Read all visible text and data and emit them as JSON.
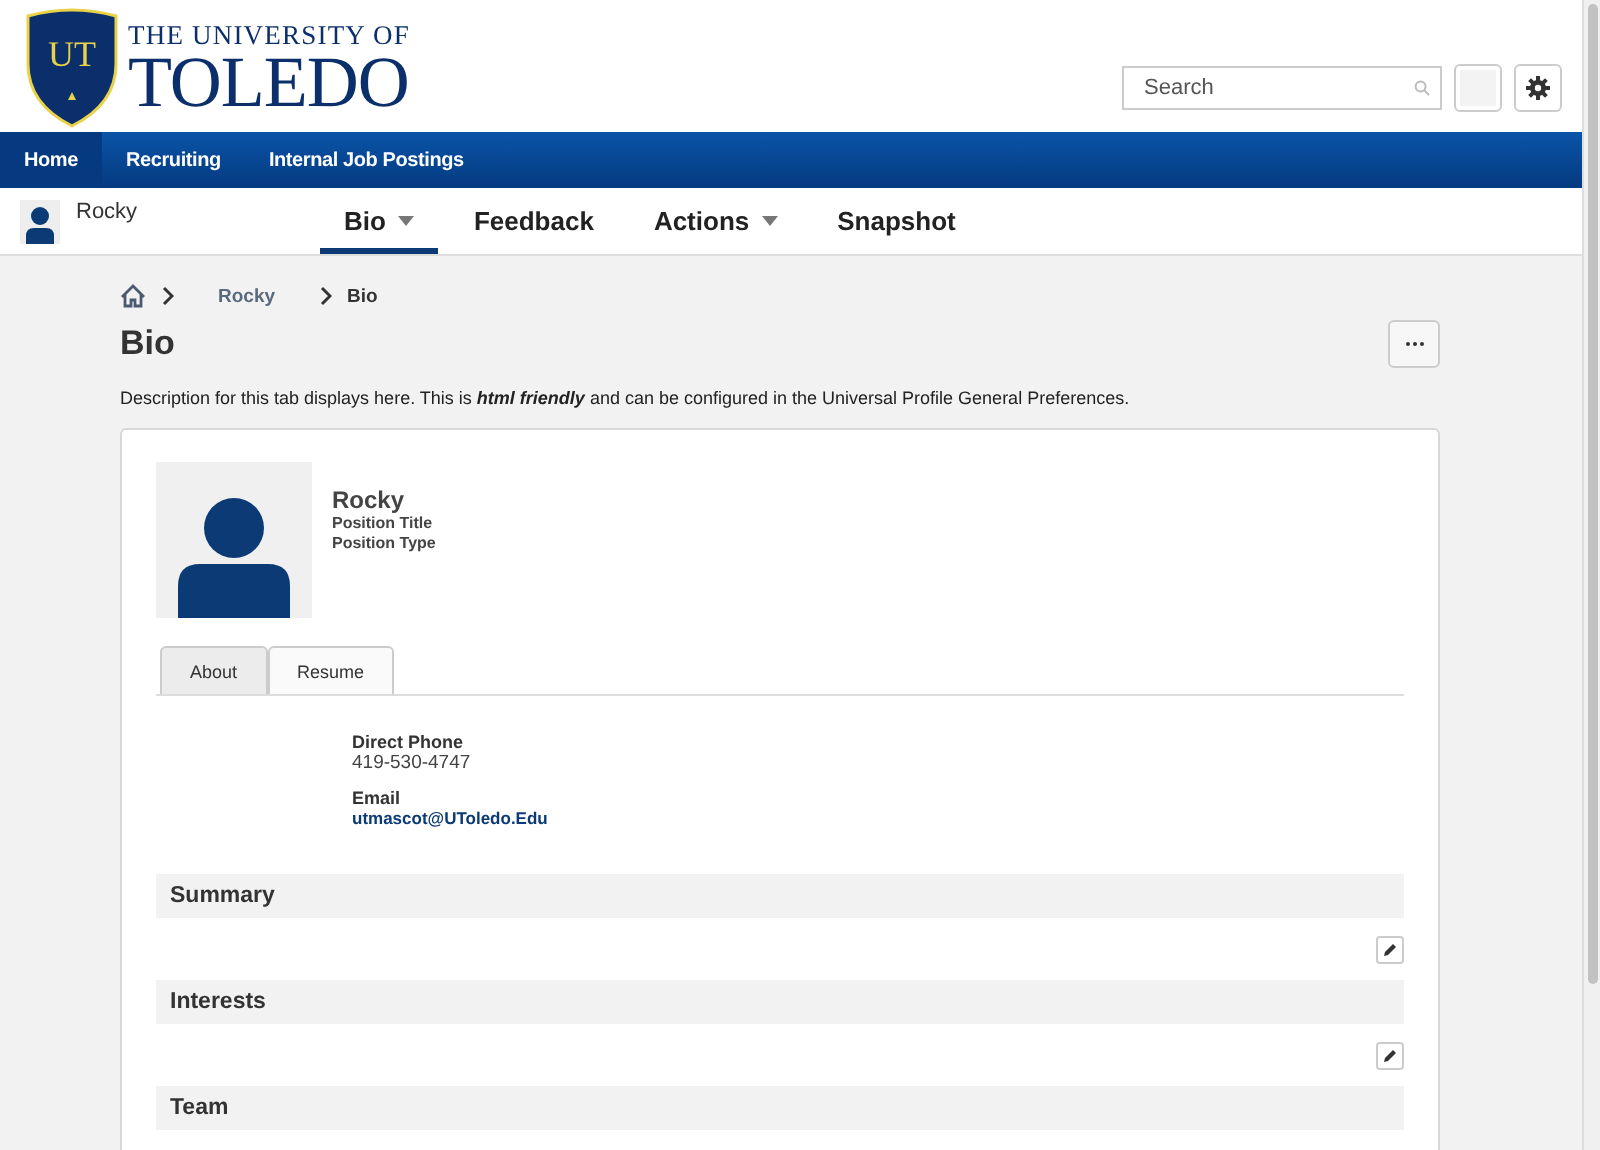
{
  "logo": {
    "monogram": "UT",
    "line1": "THE UNIVERSITY OF",
    "line2": "TOLEDO"
  },
  "search": {
    "placeholder": "Search"
  },
  "main_nav": [
    {
      "label": "Home",
      "selected": true
    },
    {
      "label": "Recruiting",
      "selected": false
    },
    {
      "label": "Internal Job Postings",
      "selected": false
    }
  ],
  "profile_bar": {
    "name": "Rocky",
    "tabs": [
      {
        "label": "Bio",
        "selected": true,
        "has_menu": true
      },
      {
        "label": "Feedback",
        "selected": false,
        "has_menu": false
      },
      {
        "label": "Actions",
        "selected": false,
        "has_menu": true
      },
      {
        "label": "Snapshot",
        "selected": false,
        "has_menu": false
      }
    ]
  },
  "breadcrumb": [
    "Rocky",
    "Bio"
  ],
  "page_title": "Bio",
  "description": "Description for this tab displays here. This is **html friendly** and can be configured in the Universal Profile General Preferences.",
  "profile": {
    "name": "Rocky",
    "position_title": "Position Title",
    "position_type": "Position Type"
  },
  "card_tabs": [
    {
      "label": "About",
      "selected": true
    },
    {
      "label": "Resume",
      "selected": false
    }
  ],
  "fields": [
    {
      "label": "Direct Phone",
      "value": "419-530-4747",
      "kind": "text"
    },
    {
      "label": "Email",
      "value": "utmascot@UToledo.Edu",
      "kind": "link"
    }
  ],
  "sections": [
    {
      "title": "Summary",
      "editable": true
    },
    {
      "title": "Interests",
      "editable": true
    },
    {
      "title": "Team",
      "editable": false
    }
  ]
}
